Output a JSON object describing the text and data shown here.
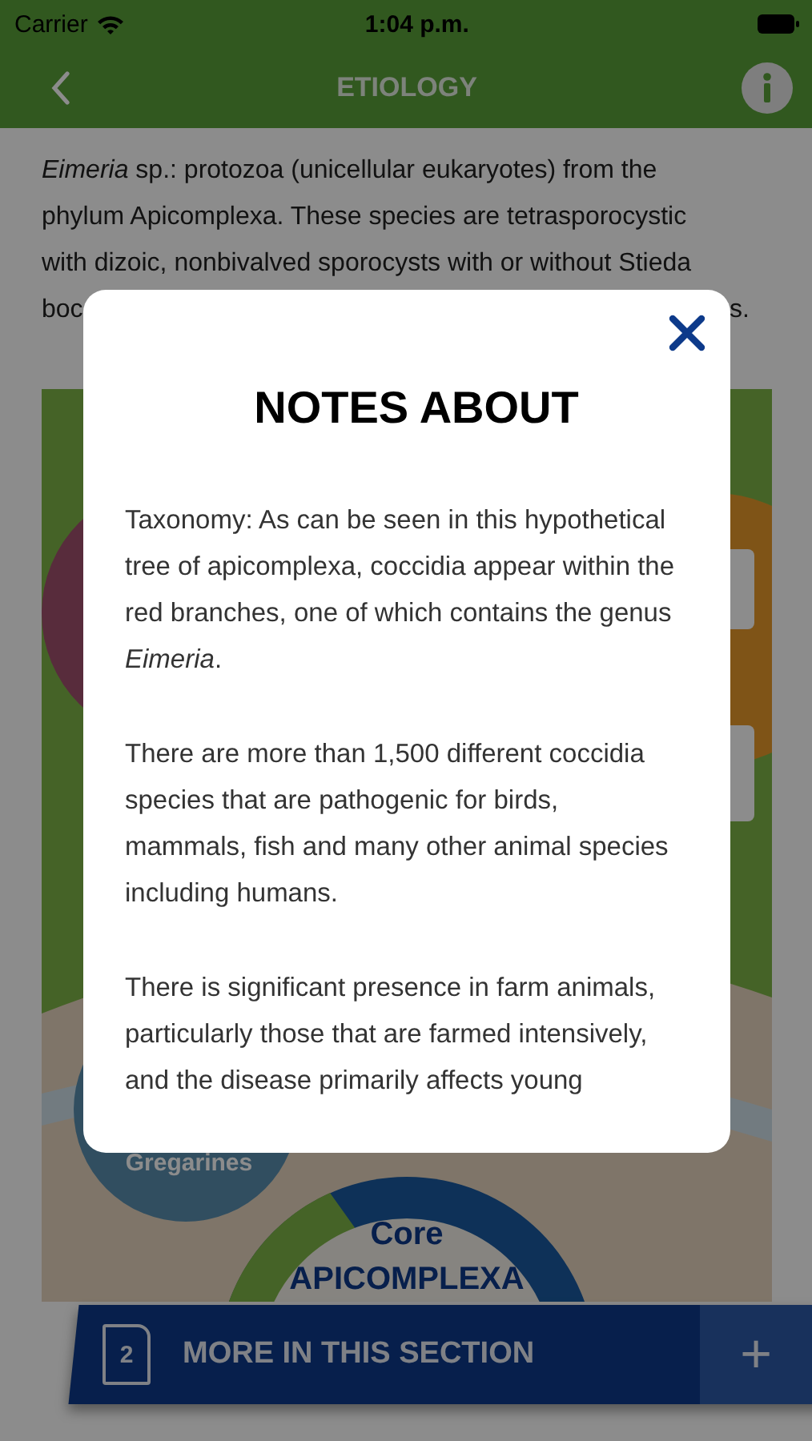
{
  "status_bar": {
    "carrier": "Carrier",
    "time": "1:04 p.m."
  },
  "nav_bar": {
    "title": "ETIOLOGY"
  },
  "intro": {
    "text": "*Eimeria* sp.: protozoa (unicellular eukaryotes) from the phylum Apicomplexa. These species are tetrasporocystic with dizoic, nonbivalved sporocysts with or without Stieda",
    "line_4_start": "boc",
    "line_4_end": "s."
  },
  "diagram": {
    "labels": [
      "Gregarines",
      "Core",
      "APICOMPLEXA"
    ]
  },
  "modal": {
    "title": "NOTES ABOUT",
    "paragraphs": [
      "Taxonomy: As can be seen in this hypothetical tree of apicomplexa, coccidia appear within the red branches, one of which contains the genus *Eimeria*.",
      "There are more than 1,500 different coccidia species that are pathogenic for birds, mammals, fish and many other animal species including humans.",
      "There is significant presence in farm animals, particularly those that are farmed intensively, and the disease primarily affects young"
    ]
  },
  "bottom_bar": {
    "badge": "2",
    "label": "MORE IN THIS SECTION",
    "action": "+"
  }
}
